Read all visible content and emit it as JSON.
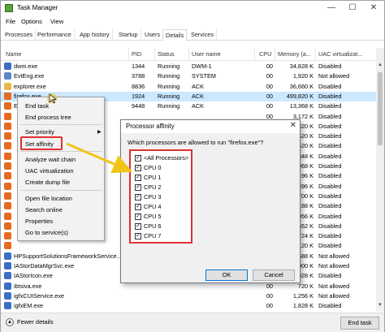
{
  "window": {
    "title": "Task Manager",
    "minimize": "—",
    "maximize": "☐",
    "close": "✕"
  },
  "menu": [
    "File",
    "Options",
    "View"
  ],
  "tabs": [
    "Processes",
    "Performance",
    "App history",
    "Startup",
    "Users",
    "Details",
    "Services"
  ],
  "active_tab": "Details",
  "columns": [
    "Name",
    "PID",
    "Status",
    "User name",
    "CPU",
    "Memory (a...",
    "UAC virtualizat..."
  ],
  "rows": [
    {
      "name": "dwm.exe",
      "pid": "1344",
      "status": "Running",
      "user": "DWM-1",
      "cpu": "00",
      "mem": "34,828 K",
      "uac": "Disabled",
      "icon_color": "#3a6fc4"
    },
    {
      "name": "EvtEng.exe",
      "pid": "3788",
      "status": "Running",
      "user": "SYSTEM",
      "cpu": "00",
      "mem": "1,920 K",
      "uac": "Not allowed",
      "icon_color": "#5a86c9"
    },
    {
      "name": "explorer.exe",
      "pid": "8836",
      "status": "Running",
      "user": "ACK",
      "cpu": "00",
      "mem": "36,660 K",
      "uac": "Disabled",
      "icon_color": "#e8b84a"
    },
    {
      "name": "firefox.exe",
      "pid": "1924",
      "status": "Running",
      "user": "ACK",
      "cpu": "00",
      "mem": "499,820 K",
      "uac": "Disabled",
      "icon_color": "#e66a1f"
    },
    {
      "name": "End task",
      "pid": "9448",
      "status": "Running",
      "user": "ACK",
      "cpu": "00",
      "mem": "13,368 K",
      "uac": "Disabled",
      "icon_color": "#e66a1f"
    },
    {
      "name": "",
      "pid": "",
      "status": "",
      "user": "",
      "cpu": "00",
      "mem": "3,172 K",
      "uac": "Disabled",
      "icon_color": "#e66a1f"
    },
    {
      "name": "",
      "pid": "",
      "status": "",
      "user": "",
      "cpu": "00",
      "mem": "3,320 K",
      "uac": "Disabled",
      "icon_color": "#e66a1f"
    },
    {
      "name": "",
      "pid": "",
      "status": "",
      "user": "",
      "cpu": "00",
      "mem": "14,520 K",
      "uac": "Disabled",
      "icon_color": "#e66a1f"
    },
    {
      "name": "",
      "pid": "",
      "status": "",
      "user": "",
      "cpu": "00",
      "mem": "36,620 K",
      "uac": "Disabled",
      "icon_color": "#e66a1f"
    },
    {
      "name": "",
      "pid": "",
      "status": "",
      "user": "",
      "cpu": "00",
      "mem": "8,348 K",
      "uac": "Disabled",
      "icon_color": "#e66a1f"
    },
    {
      "name": "",
      "pid": "",
      "status": "",
      "user": "",
      "cpu": "00",
      "mem": "2,968 K",
      "uac": "Disabled",
      "icon_color": "#e66a1f"
    },
    {
      "name": "",
      "pid": "",
      "status": "",
      "user": "",
      "cpu": "00",
      "mem": "43,496 K",
      "uac": "Disabled",
      "icon_color": "#e66a1f"
    },
    {
      "name": "",
      "pid": "",
      "status": "",
      "user": "",
      "cpu": "00",
      "mem": "3,896 K",
      "uac": "Disabled",
      "icon_color": "#e66a1f"
    },
    {
      "name": "",
      "pid": "",
      "status": "",
      "user": "",
      "cpu": "00",
      "mem": "66,700 K",
      "uac": "Disabled",
      "icon_color": "#e66a1f"
    },
    {
      "name": "",
      "pid": "",
      "status": "",
      "user": "",
      "cpu": "00",
      "mem": "3,188 K",
      "uac": "Disabled",
      "icon_color": "#e66a1f"
    },
    {
      "name": "",
      "pid": "",
      "status": "",
      "user": "",
      "cpu": "00",
      "mem": "4,056 K",
      "uac": "Disabled",
      "icon_color": "#e66a1f"
    },
    {
      "name": "",
      "pid": "",
      "status": "",
      "user": "",
      "cpu": "00",
      "mem": "19,652 K",
      "uac": "Disabled",
      "icon_color": "#e66a1f"
    },
    {
      "name": "",
      "pid": "",
      "status": "",
      "user": "",
      "cpu": "00",
      "mem": "11,724 K",
      "uac": "Disabled",
      "icon_color": "#e66a1f"
    },
    {
      "name": "",
      "pid": "",
      "status": "",
      "user": "",
      "cpu": "00",
      "mem": "3,120 K",
      "uac": "Disabled",
      "icon_color": "#e66a1f"
    },
    {
      "name": "HPSupportSolutionsFrameworkService...",
      "pid": "",
      "status": "",
      "user": "",
      "cpu": "00",
      "mem": "4,588 K",
      "uac": "Not allowed",
      "icon_color": "#3a6fc4"
    },
    {
      "name": "IAStorDataMgrSvc.exe",
      "pid": "",
      "status": "",
      "user": "",
      "cpu": "00",
      "mem": "17,000 K",
      "uac": "Not allowed",
      "icon_color": "#3a6fc4"
    },
    {
      "name": "IAStorIcon.exe",
      "pid": "",
      "status": "",
      "user": "",
      "cpu": "00",
      "mem": "3,028 K",
      "uac": "Disabled",
      "icon_color": "#3a6fc4"
    },
    {
      "name": "ibtsiva.exe",
      "pid": "",
      "status": "",
      "user": "",
      "cpu": "00",
      "mem": "720 K",
      "uac": "Not allowed",
      "icon_color": "#3a6fc4"
    },
    {
      "name": "igfxCUIService.exe",
      "pid": "",
      "status": "",
      "user": "",
      "cpu": "00",
      "mem": "1,256 K",
      "uac": "Not allowed",
      "icon_color": "#3a6fc4"
    },
    {
      "name": "igfxEM.exe",
      "pid": "",
      "status": "",
      "user": "",
      "cpu": "00",
      "mem": "1,828 K",
      "uac": "Disabled",
      "icon_color": "#3a6fc4"
    },
    {
      "name": "IntelCpHDCPSvc.exe",
      "pid": "9152",
      "status": "Running",
      "user": "ACK",
      "cpu": "00",
      "mem": "976 K",
      "uac": "Not allowed",
      "icon_color": "#3a6fc4"
    }
  ],
  "context_menu": {
    "items": [
      "End task",
      "End process tree",
      "Set priority",
      "Set affinity",
      "Analyze wait chain",
      "UAC virtualization",
      "Create dump file",
      "Open file location",
      "Search online",
      "Properties",
      "Go to service(s)"
    ]
  },
  "dialog": {
    "title": "Processor affinity",
    "question": "Which processors are allowed to run \"firefox.exe\"?",
    "options": [
      "<All Processors>",
      "CPU 0",
      "CPU 1",
      "CPU 2",
      "CPU 3",
      "CPU 4",
      "CPU 5",
      "CPU 6",
      "CPU 7"
    ],
    "ok": "OK",
    "cancel": "Cancel",
    "close": "✕"
  },
  "footer": {
    "fewer_details": "Fewer details",
    "end_task": "End task"
  },
  "colors": {
    "highlight_red": "#e03030",
    "arrow_yellow": "#f0c419",
    "selection": "#cce8ff"
  }
}
